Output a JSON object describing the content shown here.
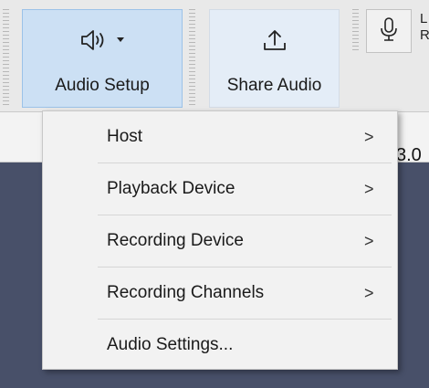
{
  "toolbar": {
    "audio_setup_label": "Audio Setup",
    "audio_setup_icon": "speaker-icon",
    "share_audio_label": "Share Audio",
    "share_audio_icon": "share-upload-icon",
    "mic_icon": "microphone-icon",
    "meter_left": "L",
    "meter_right": "R"
  },
  "ruler": {
    "value": "3.0"
  },
  "menu": {
    "items": [
      {
        "label": "Host",
        "has_submenu": true,
        "arrow": ">"
      },
      {
        "label": "Playback Device",
        "has_submenu": true,
        "arrow": ">"
      },
      {
        "label": "Recording Device",
        "has_submenu": true,
        "arrow": ">"
      },
      {
        "label": "Recording Channels",
        "has_submenu": true,
        "arrow": ">"
      },
      {
        "label": "Audio Settings...",
        "has_submenu": false,
        "arrow": ""
      }
    ]
  },
  "colors": {
    "active_button": "#cce0f4",
    "hover_button": "#e4edf7",
    "track_background": "#485069",
    "menu_background": "#f2f2f2"
  }
}
